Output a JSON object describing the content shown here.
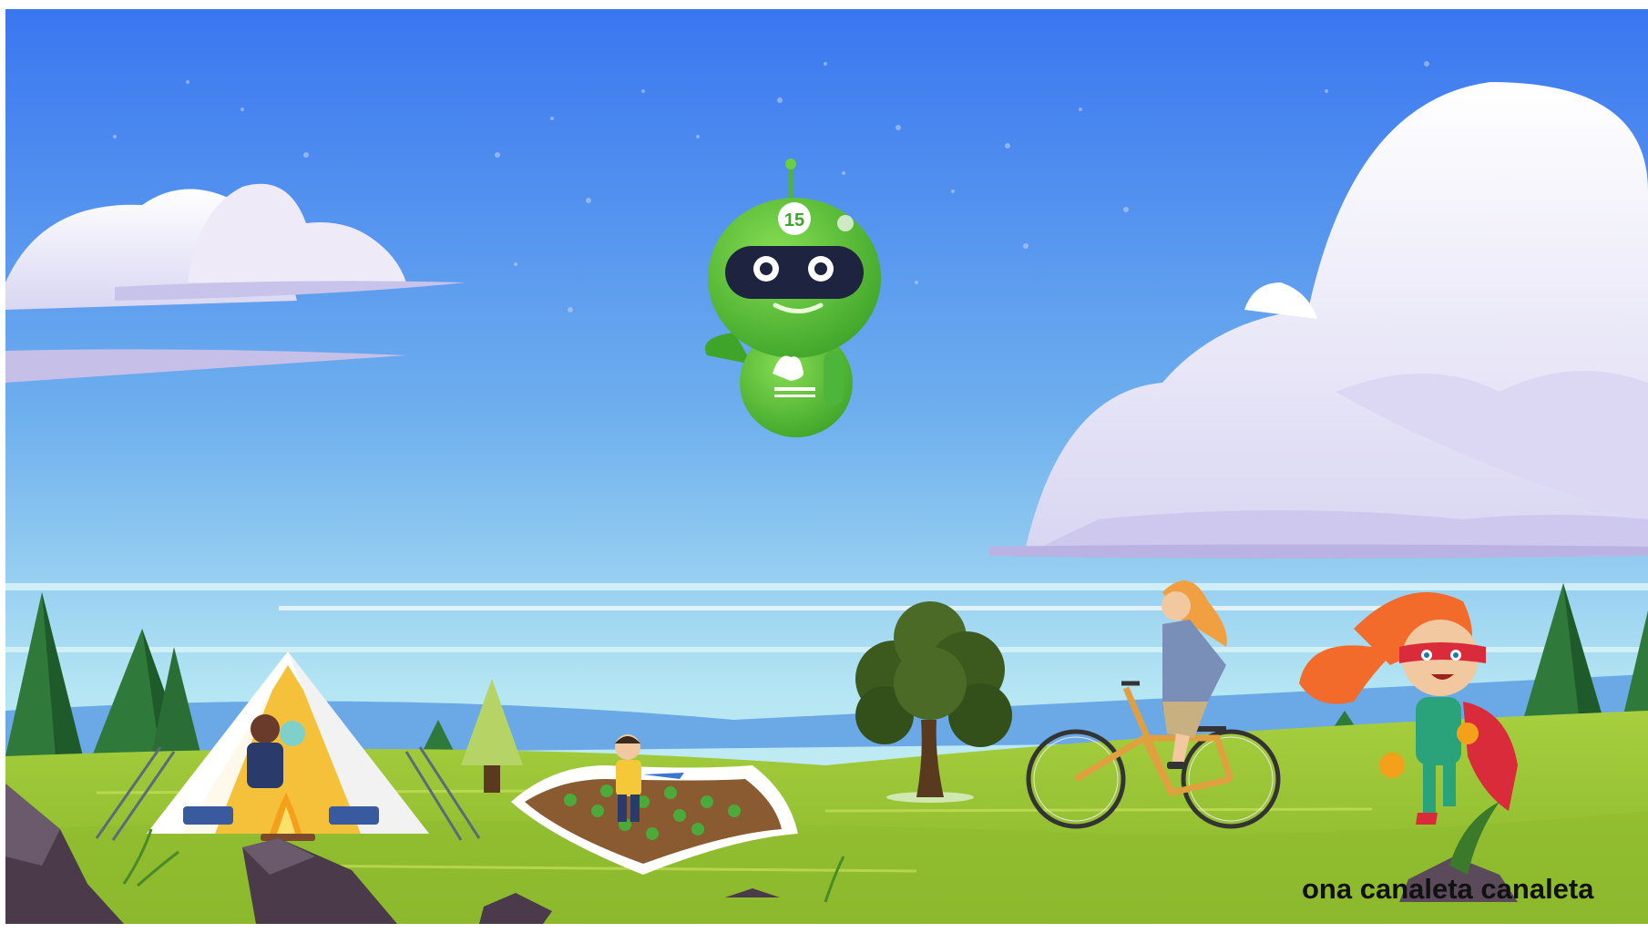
{
  "scene": {
    "robot_badge_number": "15",
    "caption": "ona canaleta canaleta"
  },
  "colors": {
    "sky_top": "#3a78f0",
    "sky_bottom": "#b9ecf4",
    "grass": "#9cc43a",
    "robot_green": "#5fc43a",
    "tent_yellow": "#f5c03a",
    "hero_hair": "#f26b2a",
    "cape_red": "#d92b3a"
  },
  "icons": [
    "robot-icon",
    "tree-icon",
    "bicycle-icon",
    "tent-icon",
    "campfire-icon"
  ]
}
